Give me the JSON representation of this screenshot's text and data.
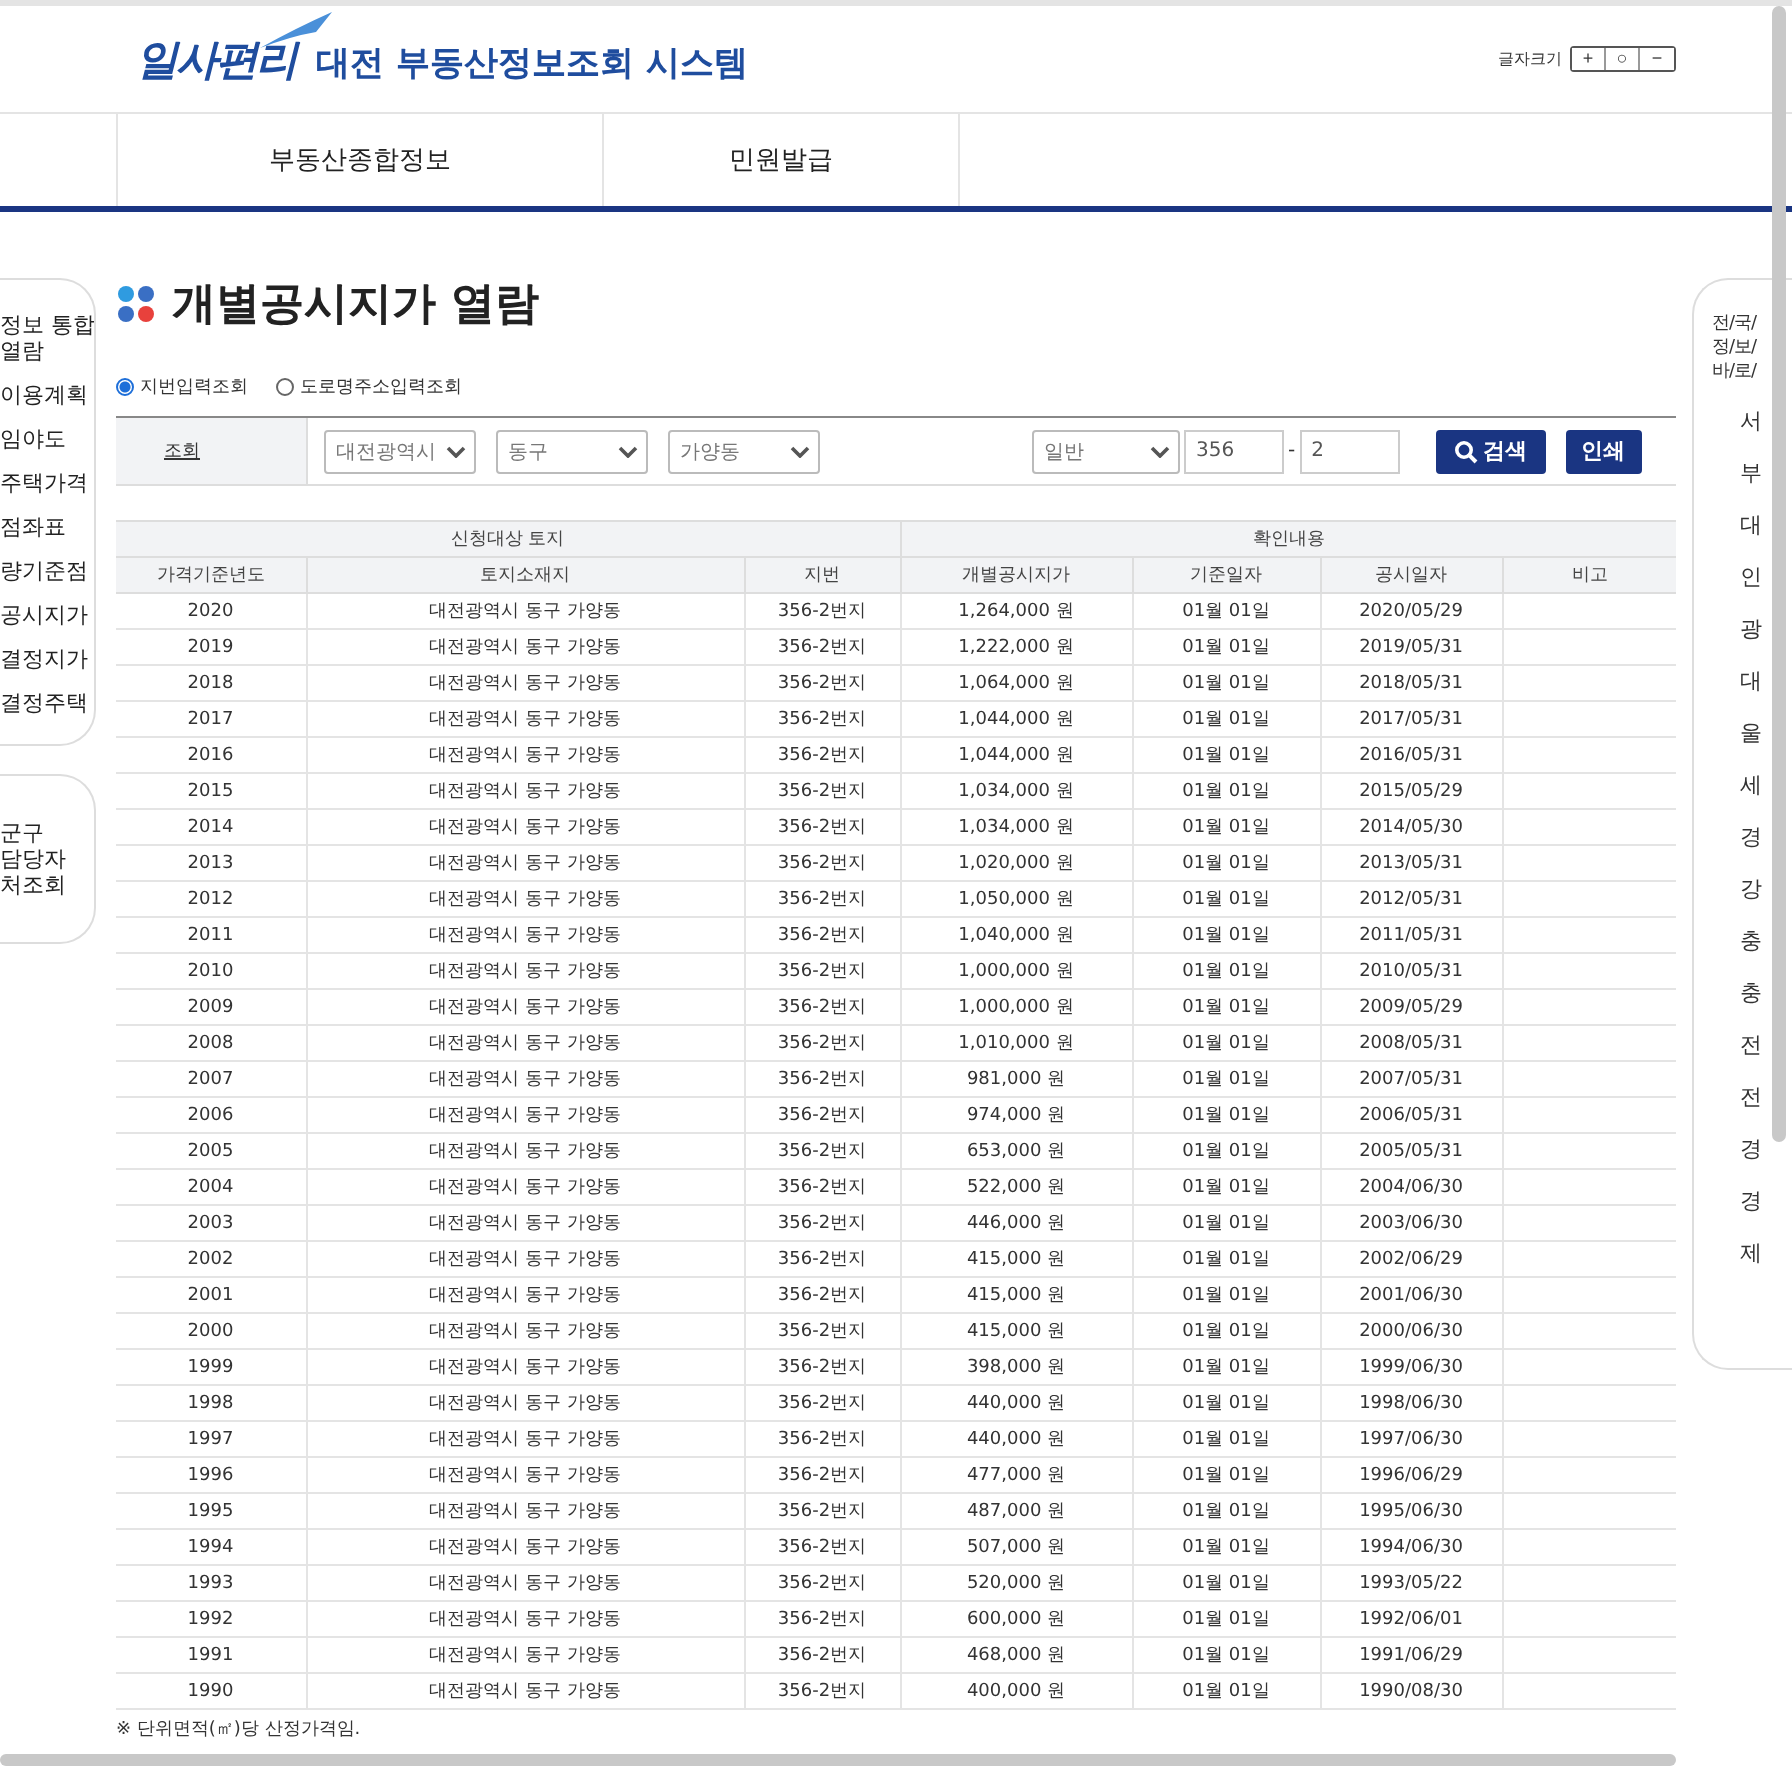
{
  "header": {
    "logo": "일사편리",
    "system_title": "대전 부동산정보조회 시스템",
    "font_size_label": "글자크기",
    "font_size_buttons": [
      "+",
      "○",
      "−"
    ]
  },
  "nav": [
    "부동산종합정보",
    "민원발급"
  ],
  "left_panel": {
    "groups": [
      [
        "정보 통합\n열람",
        "이용계획",
        "임야도",
        "주택가격",
        "점좌표",
        "량기준점",
        "공시지가",
        "결정지가",
        "결정주택"
      ],
      [
        "군구\n담당자\n처조회"
      ]
    ]
  },
  "right_panel": {
    "title": "전/국/\n정/보/\n바/로/",
    "items": [
      "서",
      "부",
      "대",
      "인",
      "광",
      "대",
      "울",
      "세",
      "경",
      "강",
      "충",
      "충",
      "전",
      "전",
      "경",
      "경",
      "제"
    ]
  },
  "page_title": "개별공시지가 열람",
  "search_modes": [
    {
      "label": "지번입력조회",
      "selected": true
    },
    {
      "label": "도로명주소입력조회",
      "selected": false
    }
  ],
  "search": {
    "label": "조회",
    "city": "대전광역시",
    "district": "동구",
    "dong": "가양동",
    "land_type": "일반",
    "main_no": "356",
    "separator": "-",
    "sub_no": "2",
    "search_button": "검색",
    "print_button": "인쇄"
  },
  "table": {
    "groups": [
      "신청대상 토지",
      "확인내용"
    ],
    "columns": [
      "가격기준년도",
      "토지소재지",
      "지번",
      "개별공시지가",
      "기준일자",
      "공시일자",
      "비고"
    ],
    "rows": [
      [
        "2020",
        "대전광역시 동구 가양동",
        "356-2번지",
        "1,264,000 원",
        "01월 01일",
        "2020/05/29"
      ],
      [
        "2019",
        "대전광역시 동구 가양동",
        "356-2번지",
        "1,222,000 원",
        "01월 01일",
        "2019/05/31"
      ],
      [
        "2018",
        "대전광역시 동구 가양동",
        "356-2번지",
        "1,064,000 원",
        "01월 01일",
        "2018/05/31"
      ],
      [
        "2017",
        "대전광역시 동구 가양동",
        "356-2번지",
        "1,044,000 원",
        "01월 01일",
        "2017/05/31"
      ],
      [
        "2016",
        "대전광역시 동구 가양동",
        "356-2번지",
        "1,044,000 원",
        "01월 01일",
        "2016/05/31"
      ],
      [
        "2015",
        "대전광역시 동구 가양동",
        "356-2번지",
        "1,034,000 원",
        "01월 01일",
        "2015/05/29"
      ],
      [
        "2014",
        "대전광역시 동구 가양동",
        "356-2번지",
        "1,034,000 원",
        "01월 01일",
        "2014/05/30"
      ],
      [
        "2013",
        "대전광역시 동구 가양동",
        "356-2번지",
        "1,020,000 원",
        "01월 01일",
        "2013/05/31"
      ],
      [
        "2012",
        "대전광역시 동구 가양동",
        "356-2번지",
        "1,050,000 원",
        "01월 01일",
        "2012/05/31"
      ],
      [
        "2011",
        "대전광역시 동구 가양동",
        "356-2번지",
        "1,040,000 원",
        "01월 01일",
        "2011/05/31"
      ],
      [
        "2010",
        "대전광역시 동구 가양동",
        "356-2번지",
        "1,000,000 원",
        "01월 01일",
        "2010/05/31"
      ],
      [
        "2009",
        "대전광역시 동구 가양동",
        "356-2번지",
        "1,000,000 원",
        "01월 01일",
        "2009/05/29"
      ],
      [
        "2008",
        "대전광역시 동구 가양동",
        "356-2번지",
        "1,010,000 원",
        "01월 01일",
        "2008/05/31"
      ],
      [
        "2007",
        "대전광역시 동구 가양동",
        "356-2번지",
        "981,000 원",
        "01월 01일",
        "2007/05/31"
      ],
      [
        "2006",
        "대전광역시 동구 가양동",
        "356-2번지",
        "974,000 원",
        "01월 01일",
        "2006/05/31"
      ],
      [
        "2005",
        "대전광역시 동구 가양동",
        "356-2번지",
        "653,000 원",
        "01월 01일",
        "2005/05/31"
      ],
      [
        "2004",
        "대전광역시 동구 가양동",
        "356-2번지",
        "522,000 원",
        "01월 01일",
        "2004/06/30"
      ],
      [
        "2003",
        "대전광역시 동구 가양동",
        "356-2번지",
        "446,000 원",
        "01월 01일",
        "2003/06/30"
      ],
      [
        "2002",
        "대전광역시 동구 가양동",
        "356-2번지",
        "415,000 원",
        "01월 01일",
        "2002/06/29"
      ],
      [
        "2001",
        "대전광역시 동구 가양동",
        "356-2번지",
        "415,000 원",
        "01월 01일",
        "2001/06/30"
      ],
      [
        "2000",
        "대전광역시 동구 가양동",
        "356-2번지",
        "415,000 원",
        "01월 01일",
        "2000/06/30"
      ],
      [
        "1999",
        "대전광역시 동구 가양동",
        "356-2번지",
        "398,000 원",
        "01월 01일",
        "1999/06/30"
      ],
      [
        "1998",
        "대전광역시 동구 가양동",
        "356-2번지",
        "440,000 원",
        "01월 01일",
        "1998/06/30"
      ],
      [
        "1997",
        "대전광역시 동구 가양동",
        "356-2번지",
        "440,000 원",
        "01월 01일",
        "1997/06/30"
      ],
      [
        "1996",
        "대전광역시 동구 가양동",
        "356-2번지",
        "477,000 원",
        "01월 01일",
        "1996/06/29"
      ],
      [
        "1995",
        "대전광역시 동구 가양동",
        "356-2번지",
        "487,000 원",
        "01월 01일",
        "1995/06/30"
      ],
      [
        "1994",
        "대전광역시 동구 가양동",
        "356-2번지",
        "507,000 원",
        "01월 01일",
        "1994/06/30"
      ],
      [
        "1993",
        "대전광역시 동구 가양동",
        "356-2번지",
        "520,000 원",
        "01월 01일",
        "1993/05/22"
      ],
      [
        "1992",
        "대전광역시 동구 가양동",
        "356-2번지",
        "600,000 원",
        "01월 01일",
        "1992/06/01"
      ],
      [
        "1991",
        "대전광역시 동구 가양동",
        "356-2번지",
        "468,000 원",
        "01월 01일",
        "1991/06/29"
      ],
      [
        "1990",
        "대전광역시 동구 가양동",
        "356-2번지",
        "400,000 원",
        "01월 01일",
        "1990/08/30"
      ]
    ]
  },
  "footnote": "※ 단위면적(㎡)당 산정가격임."
}
